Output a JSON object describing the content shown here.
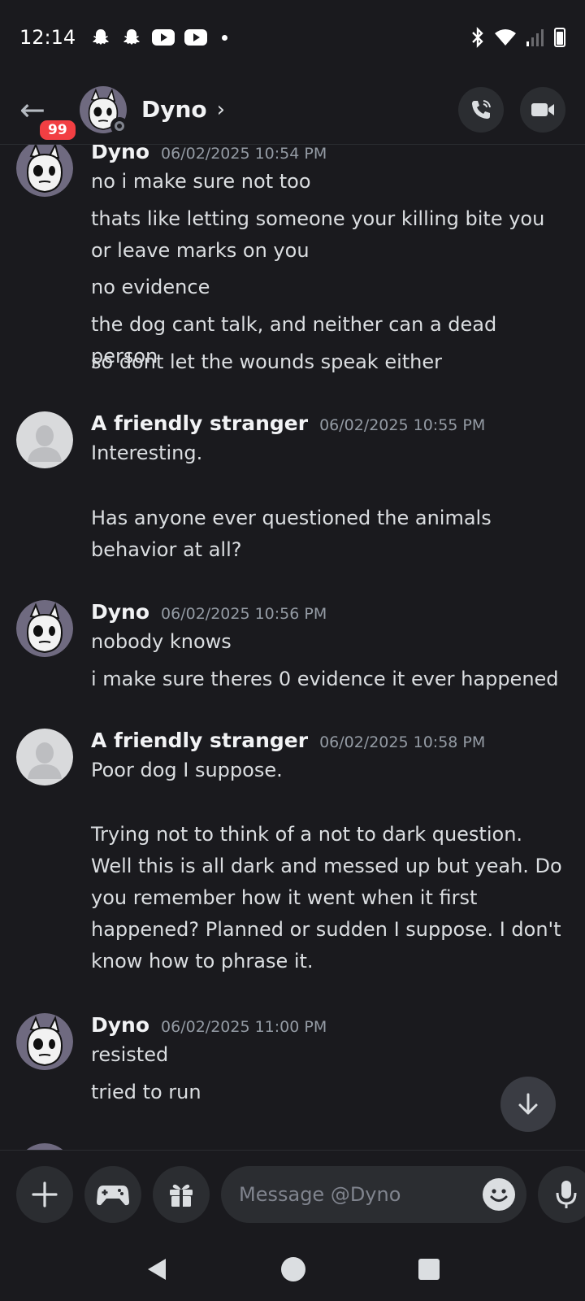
{
  "status_bar": {
    "time": "12:14",
    "left_icons": [
      "snapchat-icon",
      "snapchat-icon",
      "youtube-icon",
      "youtube-icon",
      "notification-dot"
    ],
    "right_icons": [
      "bluetooth-icon",
      "wifi-icon",
      "signal-icon",
      "battery-icon"
    ]
  },
  "header": {
    "unread_count": "99",
    "name": "Dyno",
    "chevron": "›",
    "status": "offline"
  },
  "messages": [
    {
      "author": "Dyno",
      "timestamp": "06/02/2025 10:54 PM",
      "avatar": "dyno-avatar",
      "lines": [
        "no i make sure not too",
        "thats like letting someone your killing bite you or leave marks on you",
        "no evidence",
        "the dog cant talk, and neither can a dead person",
        "so dont let the wounds speak either"
      ]
    },
    {
      "author": "A friendly stranger",
      "timestamp": "06/02/2025 10:55 PM",
      "avatar": "default-avatar",
      "lines": [
        "Interesting.",
        "Has anyone ever questioned the animals behavior at all?"
      ]
    },
    {
      "author": "Dyno",
      "timestamp": "06/02/2025 10:56 PM",
      "avatar": "dyno-avatar",
      "lines": [
        "nobody knows",
        "i make sure theres 0 evidence it ever happened"
      ]
    },
    {
      "author": "A friendly stranger",
      "timestamp": "06/02/2025 10:58 PM",
      "avatar": "default-avatar",
      "lines": [
        "Poor dog I suppose.",
        "Trying not to think of a not to dark question. Well this is all dark and messed up but yeah. Do you remember how it went when it first happened? Planned or sudden I suppose. I don't know how to phrase it."
      ]
    },
    {
      "author": "Dyno",
      "timestamp": "06/02/2025 11:00 PM",
      "avatar": "dyno-avatar",
      "lines": [
        "resisted",
        "tried to run"
      ]
    }
  ],
  "composer": {
    "placeholder": "Message @Dyno"
  },
  "colors": {
    "background": "#1a1a1e",
    "surface": "#2b2d31",
    "badge": "#f23f43",
    "text": "#dbdee1",
    "muted": "#949ba4"
  }
}
